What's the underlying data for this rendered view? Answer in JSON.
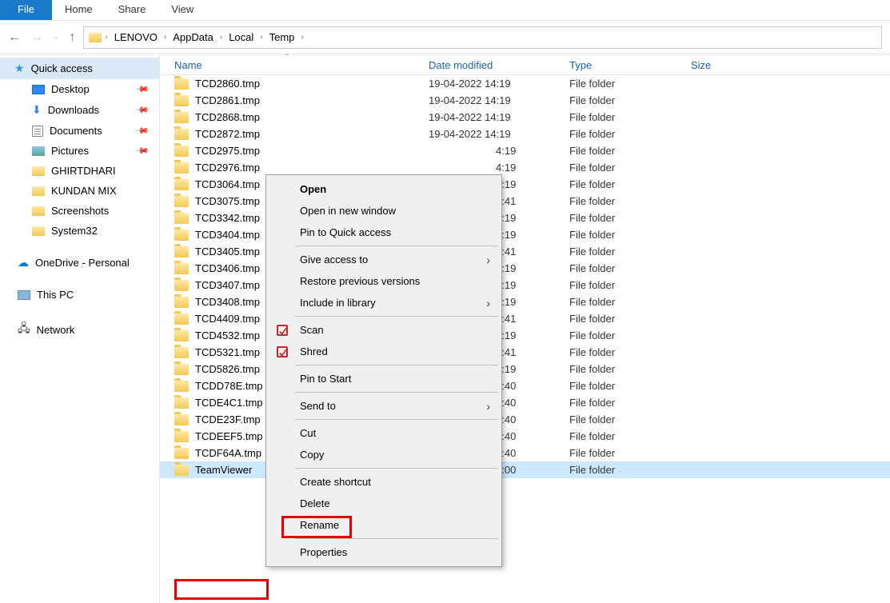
{
  "ribbon": {
    "file": "File",
    "home": "Home",
    "share": "Share",
    "view": "View"
  },
  "breadcrumb": [
    "LENOVO",
    "AppData",
    "Local",
    "Temp"
  ],
  "sidebar": {
    "quick_access": "Quick access",
    "desktop": "Desktop",
    "downloads": "Downloads",
    "documents": "Documents",
    "pictures": "Pictures",
    "ghirtdhari": "GHIRTDHARI",
    "kundan_mix": "KUNDAN MIX",
    "screenshots": "Screenshots",
    "system32": "System32",
    "onedrive": "OneDrive - Personal",
    "this_pc": "This PC",
    "network": "Network"
  },
  "columns": {
    "name": "Name",
    "date": "Date modified",
    "type": "Type",
    "size": "Size"
  },
  "file_type": "File folder",
  "rows": [
    {
      "name": "TCD2860.tmp",
      "date": "19-04-2022 14:19"
    },
    {
      "name": "TCD2861.tmp",
      "date": "19-04-2022 14:19"
    },
    {
      "name": "TCD2868.tmp",
      "date": "19-04-2022 14:19"
    },
    {
      "name": "TCD2872.tmp",
      "date": "19-04-2022 14:19"
    },
    {
      "name": "TCD2975.tmp",
      "date_suffix": "4:19"
    },
    {
      "name": "TCD2976.tmp",
      "date_suffix": "4:19"
    },
    {
      "name": "TCD3064.tmp",
      "date_suffix": "4:19"
    },
    {
      "name": "TCD3075.tmp",
      "date_suffix": "1:41"
    },
    {
      "name": "TCD3342.tmp",
      "date_suffix": "4:19"
    },
    {
      "name": "TCD3404.tmp",
      "date_suffix": "4:19"
    },
    {
      "name": "TCD3405.tmp",
      "date_suffix": "1:41"
    },
    {
      "name": "TCD3406.tmp",
      "date_suffix": "4:19"
    },
    {
      "name": "TCD3407.tmp",
      "date_suffix": "4:19"
    },
    {
      "name": "TCD3408.tmp",
      "date_suffix": "4:19"
    },
    {
      "name": "TCD4409.tmp",
      "date_suffix": "1:41"
    },
    {
      "name": "TCD4532.tmp",
      "date_suffix": "4:19"
    },
    {
      "name": "TCD5321.tmp",
      "date_suffix": "1:41"
    },
    {
      "name": "TCD5826.tmp",
      "date_suffix": "4:19"
    },
    {
      "name": "TCDD78E.tmp",
      "date_suffix": "2:40"
    },
    {
      "name": "TCDE4C1.tmp",
      "date_suffix": "2:40"
    },
    {
      "name": "TCDE23F.tmp",
      "date_suffix": "2:40"
    },
    {
      "name": "TCDEEF5.tmp",
      "date_suffix": "2:40"
    },
    {
      "name": "TCDF64A.tmp",
      "date_suffix": "2:40"
    },
    {
      "name": "TeamViewer",
      "date_suffix": "1:00",
      "selected": true
    }
  ],
  "context_menu": {
    "open": "Open",
    "open_new_window": "Open in new window",
    "pin_quick_access": "Pin to Quick access",
    "give_access": "Give access to",
    "restore_versions": "Restore previous versions",
    "include_library": "Include in library",
    "scan": "Scan",
    "shred": "Shred",
    "pin_start": "Pin to Start",
    "send_to": "Send to",
    "cut": "Cut",
    "copy": "Copy",
    "create_shortcut": "Create shortcut",
    "delete": "Delete",
    "rename": "Rename",
    "properties": "Properties"
  }
}
